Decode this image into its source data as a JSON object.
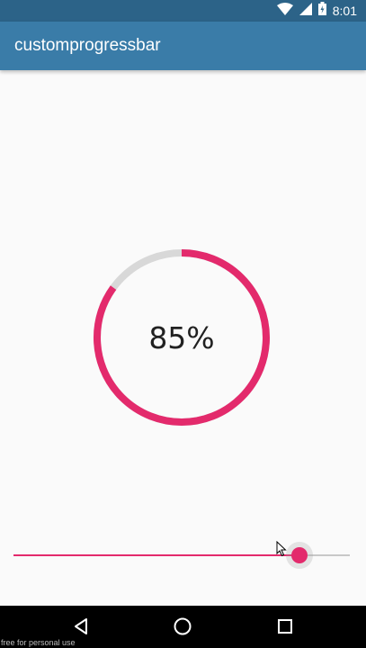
{
  "status_bar": {
    "time": "8:01",
    "icons": [
      "wifi-icon",
      "cellular-icon",
      "battery-icon"
    ],
    "background": "#2c6388"
  },
  "app_bar": {
    "title": "customprogressbar",
    "background": "#3a7ca8"
  },
  "progress": {
    "value": 85,
    "label": "85%",
    "color": "#e32a6c",
    "track_color": "#d8d8d8"
  },
  "slider": {
    "value": 0.85,
    "color": "#e32a6c"
  },
  "navigation": {
    "icons": [
      "back-icon",
      "home-icon",
      "recents-icon"
    ]
  },
  "watermark": "free for personal use"
}
